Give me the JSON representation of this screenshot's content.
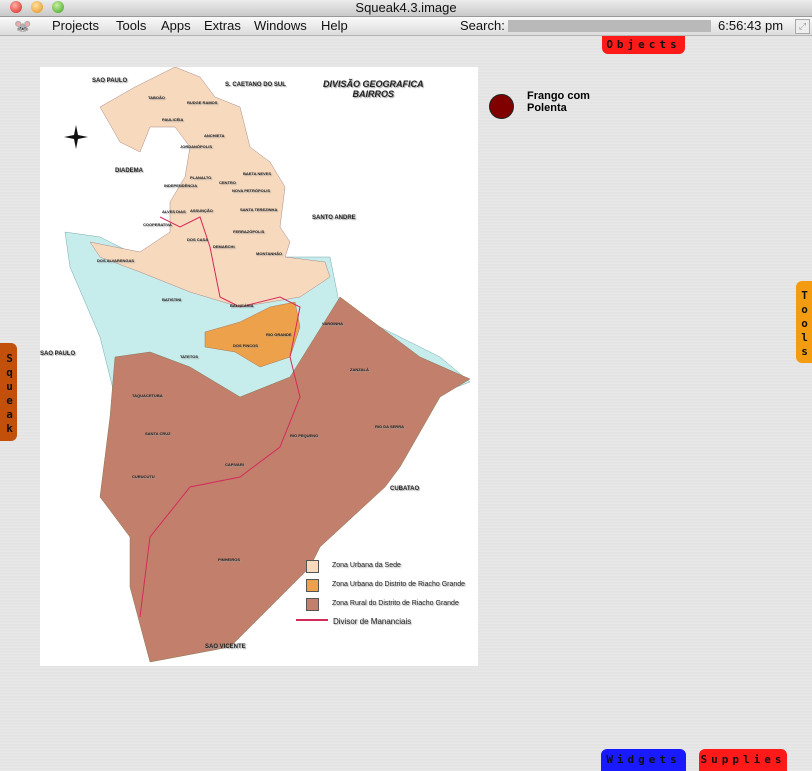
{
  "window": {
    "title": "Squeak4.3.image"
  },
  "menubar": {
    "items": [
      "Projects",
      "Tools",
      "Apps",
      "Extras",
      "Windows",
      "Help"
    ],
    "search_label": "Search:",
    "search_value": "",
    "clock": "6:56:43 pm"
  },
  "flaps": {
    "objects": "Objects",
    "tools": "Tools",
    "squeak": "Squeak",
    "widgets": "Widgets",
    "supplies": "Supplies"
  },
  "colors": {
    "objects": "#ff1a1a",
    "tools": "#f39c12",
    "squeak": "#c2500a",
    "widgets": "#1a1aff",
    "supplies": "#ff1a1a",
    "dot": "#800000"
  },
  "morph": {
    "label_line1": "Frango com",
    "label_line2": "Polenta"
  },
  "map": {
    "title_line1": "DIVISÃO GEOGRAFICA",
    "title_line2": "BAIRROS",
    "region_labels": [
      "SAO PAULO",
      "S. CAETANO DO SUL",
      "DIADEMA",
      "SANTO ANDRE",
      "SAO PAULO",
      "CUBATAO",
      "SAO VICENTE"
    ],
    "district_labels": [
      "TABOÃO",
      "RUDGE RAMOS",
      "PAULICÉIA",
      "ANCHIETA",
      "JORDANÓPOLIS",
      "PLANALTO",
      "BAETA NEVES",
      "INDEPENDÊNCIA",
      "CENTRO",
      "NOVA PETRÓPOLIS",
      "ALVES DIAS",
      "ASSUNÇÃO",
      "SANTA TEREZINHA",
      "COOPERATIVA",
      "FERRAZÓPOLIS",
      "DOS CASA",
      "DEMARCHI",
      "MONTANHÃO",
      "DOS ALVARENGAS",
      "BATISTINI",
      "BALNEÁRIA",
      "TATETOS",
      "RIO GRANDE",
      "VARGINHA",
      "ZANZALÁ",
      "DOS FINCOS",
      "TAQUACETUBA",
      "SANTA CRUZ",
      "CAPIVARI",
      "RIO PEQUENO",
      "RIO DA SERRA",
      "CURUCUTU",
      "PINHEIROS"
    ],
    "legend": [
      {
        "label": "Zona Urbana da Sede",
        "color": "#f7d9bd"
      },
      {
        "label": "Zona Urbana do Distrito de Riacho Grande",
        "color": "#eea14b"
      },
      {
        "label": "Zona Rural do Distrito de Riacho Grande",
        "color": "#c2806c"
      },
      {
        "label": "Divisor de Mananciais",
        "color": "#d42a5a"
      }
    ]
  }
}
